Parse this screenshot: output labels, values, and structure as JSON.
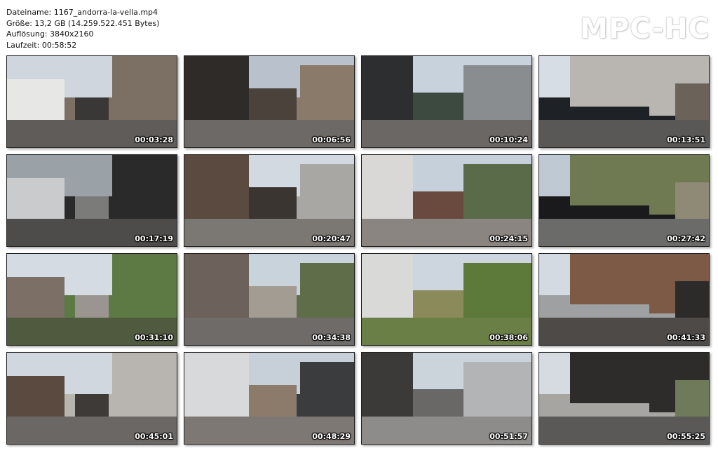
{
  "file_info": {
    "filename_line": "Dateiname: 1167_andorra-la-vella.mp4",
    "size_line": "Größe: 13,2 GB (14.259.522.451 Bytes)",
    "resolution_line": "Auflösung: 3840x2160",
    "runtime_line": "Laufzeit: 00:58:52"
  },
  "brand": "MPC-HC",
  "thumbnails": [
    {
      "timestamp": "00:03:28",
      "sky": "#cfd6de",
      "ground": "#5f5c5a",
      "a": "#e7e7e5",
      "b": "#7c6f64",
      "c": "#3a3836"
    },
    {
      "timestamp": "00:06:56",
      "sky": "#b9c2cc",
      "ground": "#6d6966",
      "a": "#2f2b28",
      "b": "#8a7a6a",
      "c": "#4b423b"
    },
    {
      "timestamp": "00:10:24",
      "sky": "#c8d2dc",
      "ground": "#6a6764",
      "a": "#2c2e2f",
      "b": "#8a8d90",
      "c": "#3d4a3f"
    },
    {
      "timestamp": "00:13:51",
      "sky": "#d6dde4",
      "ground": "#5a5856",
      "a": "#b9b6b2",
      "b": "#1e2226",
      "c": "#6b6259"
    },
    {
      "timestamp": "00:17:19",
      "sky": "#9aa2a8",
      "ground": "#4e4c4a",
      "a": "#c9cbcc",
      "b": "#2a2a2a",
      "c": "#7b7b7a"
    },
    {
      "timestamp": "00:20:47",
      "sky": "#d2d9e0",
      "ground": "#7b7773",
      "a": "#5a4a40",
      "b": "#a9a7a4",
      "c": "#3b3532"
    },
    {
      "timestamp": "00:24:15",
      "sky": "#c5d0da",
      "ground": "#8a8580",
      "a": "#d9d8d6",
      "b": "#5a6b4a",
      "c": "#6a4a3e"
    },
    {
      "timestamp": "00:27:42",
      "sky": "#bfc9d3",
      "ground": "#6b6b69",
      "a": "#6f7a52",
      "b": "#1a1a1c",
      "c": "#8e8a76"
    },
    {
      "timestamp": "00:31:10",
      "sky": "#d4dbe2",
      "ground": "#505a3e",
      "a": "#7b6f66",
      "b": "#5d7a45",
      "c": "#9a9590"
    },
    {
      "timestamp": "00:34:38",
      "sky": "#c9d3dc",
      "ground": "#6e6b68",
      "a": "#6d625b",
      "b": "#5f6e48",
      "c": "#a39c93"
    },
    {
      "timestamp": "00:38:06",
      "sky": "#cdd6df",
      "ground": "#6a7f45",
      "a": "#d9d9d8",
      "b": "#5d7a3a",
      "c": "#8b8a5a"
    },
    {
      "timestamp": "00:41:33",
      "sky": "#d3dae1",
      "ground": "#4d4a47",
      "a": "#7c5a45",
      "b": "#9ea0a2",
      "c": "#2d2b29"
    },
    {
      "timestamp": "00:45:01",
      "sky": "#d0d7de",
      "ground": "#6b6764",
      "a": "#5b4a3f",
      "b": "#b8b5b1",
      "c": "#3d3a37"
    },
    {
      "timestamp": "00:48:29",
      "sky": "#c7d0d9",
      "ground": "#7d7873",
      "a": "#d8d9da",
      "b": "#3a3c3e",
      "c": "#8c7b6a"
    },
    {
      "timestamp": "00:51:57",
      "sky": "#cbd3db",
      "ground": "#8d8c8a",
      "a": "#3c3a39",
      "b": "#b2b4b6",
      "c": "#6a6866"
    },
    {
      "timestamp": "00:55:25",
      "sky": "#d5dbe1",
      "ground": "#5b5957",
      "a": "#2e2c2a",
      "b": "#a7a5a2",
      "c": "#6e7a5a"
    }
  ]
}
